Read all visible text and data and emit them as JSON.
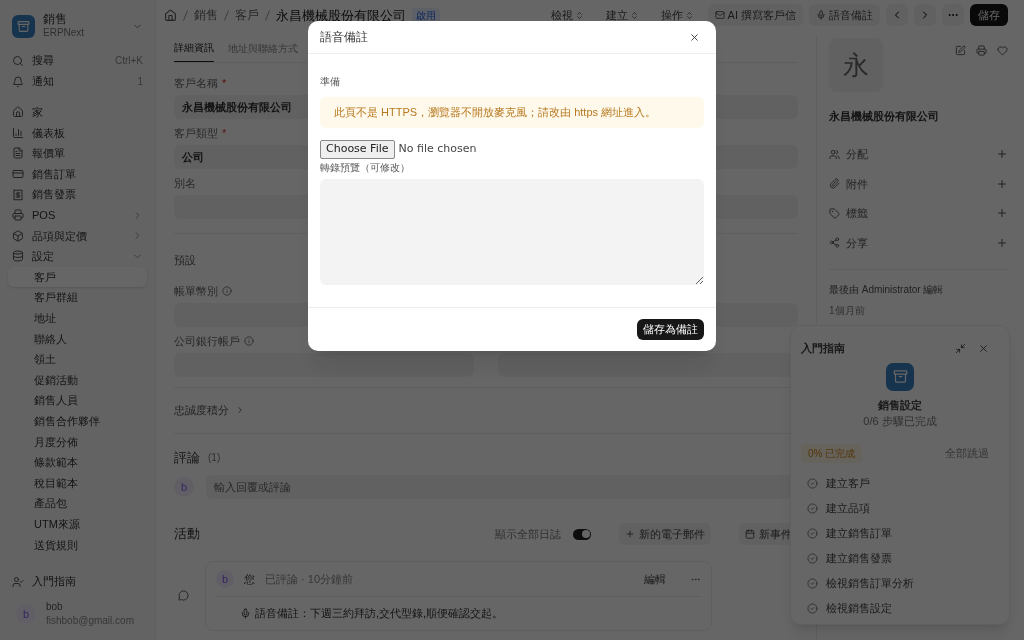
{
  "sidebar": {
    "app": {
      "title": "銷售",
      "subtitle": "ERPNext"
    },
    "utility": [
      {
        "label": "搜尋",
        "hint": "Ctrl+K"
      },
      {
        "label": "通知",
        "hint": "1"
      }
    ],
    "items": [
      {
        "kind": "link",
        "label": "家"
      },
      {
        "kind": "link",
        "label": "儀表板"
      },
      {
        "kind": "link",
        "label": "報價單"
      },
      {
        "kind": "link",
        "label": "銷售訂單"
      },
      {
        "kind": "link",
        "label": "銷售發票"
      },
      {
        "kind": "group",
        "label": "POS",
        "expanded": false
      },
      {
        "kind": "group",
        "label": "品項與定價",
        "expanded": false
      },
      {
        "kind": "group",
        "label": "設定",
        "expanded": true,
        "children": [
          {
            "label": "客戶",
            "selected": true
          },
          {
            "label": "客戶群組",
            "selected": false
          },
          {
            "label": "地址",
            "selected": false
          },
          {
            "label": "聯絡人",
            "selected": false
          },
          {
            "label": "領土",
            "selected": false
          },
          {
            "label": "促銷活動",
            "selected": false
          },
          {
            "label": "銷售人員",
            "selected": false
          },
          {
            "label": "銷售合作夥伴",
            "selected": false
          },
          {
            "label": "月度分佈",
            "selected": false
          },
          {
            "label": "條款範本",
            "selected": false
          },
          {
            "label": "稅目範本",
            "selected": false
          },
          {
            "label": "產品包",
            "selected": false
          },
          {
            "label": "UTM來源",
            "selected": false
          },
          {
            "label": "送貨規則",
            "selected": false
          }
        ]
      }
    ],
    "guide": "入門指南",
    "user": {
      "initial": "b",
      "name": "bob",
      "email": "fishbob@gmail.com"
    }
  },
  "topbar": {
    "breadcrumbs": [
      "銷售",
      "客戶"
    ],
    "title": "永昌機械股份有限公司",
    "status": "啟用",
    "menus": [
      "檢視",
      "建立",
      "操作"
    ],
    "actions": [
      "AI 撰寫客戶信",
      "語音備註"
    ],
    "save": "儲存"
  },
  "tabs": [
    {
      "label": "詳細資訊",
      "selected": true
    },
    {
      "label": "地址與聯絡方式",
      "selected": false
    }
  ],
  "form": {
    "fields": [
      {
        "label": "客戶名稱",
        "mark": "*",
        "info": false,
        "value": "永昌機械股份有限公司"
      },
      {
        "label": "客戶類型",
        "mark": "*",
        "info": false,
        "value": "公司"
      },
      {
        "label": "別名",
        "info": false
      }
    ],
    "section": "預設",
    "section_fields": [
      {
        "label": "帳單幣別",
        "info": true
      },
      {
        "label": "公司銀行帳戶",
        "info": true
      }
    ],
    "collapsed_section": "忠誠度積分"
  },
  "comments": {
    "title": "評論",
    "count": "(1)",
    "avatar": "b",
    "placeholder": "輸入回覆或評論"
  },
  "activity": {
    "title": "活動",
    "toggle": {
      "label": "顯示全部日誌",
      "on": true
    },
    "buttons": [
      "新的電子郵件",
      "新事件"
    ],
    "entries": [
      {
        "avatar": "b",
        "author": "您",
        "meta": "已評論 · 10分鐘前",
        "edit": "編輯",
        "body": "語音備註：下週三約拜訪,交代型錄,順便確認交起。"
      }
    ]
  },
  "side": {
    "avatar": "永",
    "name": "永昌機械股份有限公司",
    "actions": [
      "分配",
      "附件",
      "標籤",
      "分享"
    ],
    "modified": "最後由 Administrator 編輯",
    "modified_time": "1個月前"
  },
  "onboarding": {
    "title": "入門指南",
    "module": "銷售設定",
    "progress": "0/6 步驟已完成",
    "percent": "0% 已完成",
    "skip": "全部跳過",
    "steps": [
      "建立客戶",
      "建立品項",
      "建立銷售訂單",
      "建立銷售發票",
      "檢視銷售訂單分析",
      "檢視銷售設定"
    ]
  },
  "modal": {
    "title": "語音備註",
    "status": "準備",
    "warning": "此頁不是 HTTPS，瀏覽器不開放麥克風；請改由 https 網址進入。",
    "file_button": "Choose File",
    "file_status": "No file chosen",
    "preview_label": "轉錄預覽（可修改）",
    "save": "儲存為備註"
  }
}
